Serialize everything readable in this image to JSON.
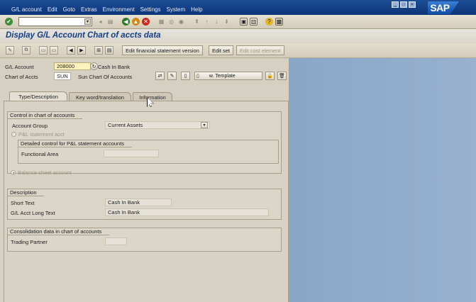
{
  "menubar": {
    "items": [
      "G/L account",
      "Edit",
      "Goto",
      "Extras",
      "Environment",
      "Settings",
      "System",
      "Help"
    ],
    "brand": "SAP"
  },
  "header": {
    "title": "Display G/L Account Chart of accts data"
  },
  "app_toolbar": {
    "buttons": [
      "Edit financial statement version",
      "Edit set",
      "Edit cost element"
    ]
  },
  "account": {
    "gl_account_label": "G/L Account",
    "gl_account_value": "208000",
    "gl_account_text": "Cash In Bank",
    "chart_label": "Chart of Accts",
    "chart_value": "SUN",
    "chart_text": "Sun Chart Of Accounts",
    "template_button": "w. Template"
  },
  "tabs": [
    {
      "label": "Type/Description",
      "active": true
    },
    {
      "label": "Key word/translation",
      "active": false
    },
    {
      "label": "Information",
      "active": false
    }
  ],
  "control_group": {
    "title": "Control in chart of accounts",
    "account_group_label": "Account Group",
    "account_group_value": "Current Assets",
    "pl_label": "P&L statement acct",
    "detail_title": "Detailed control for P&L statement accounts",
    "functional_area_label": "Functional Area",
    "balance_label": "Balance sheet account"
  },
  "description_group": {
    "title": "Description",
    "short_text_label": "Short Text",
    "short_text_value": "Cash In Bank",
    "long_text_label": "G/L Acct Long Text",
    "long_text_value": "Cash In Bank"
  },
  "consolidation_group": {
    "title": "Consolidation data in chart of accounts",
    "trading_partner_label": "Trading Partner"
  },
  "colors": {
    "menubar": "#0d3478",
    "title": "#123f86",
    "required_field": "#fdf2bc",
    "panel": "#d6d0c2",
    "desktop": "#8fa9c8"
  }
}
